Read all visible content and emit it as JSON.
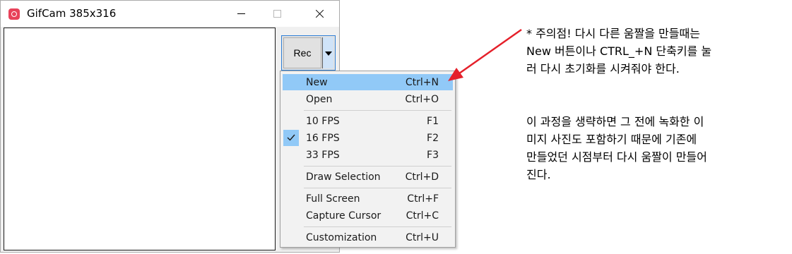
{
  "window": {
    "title": "GifCam 385x316",
    "icon": "camera-icon",
    "rec_label": "Rec"
  },
  "menu": {
    "items": [
      {
        "label": "New",
        "shortcut": "Ctrl+N",
        "highlighted": true
      },
      {
        "label": "Open",
        "shortcut": "Ctrl+O"
      },
      {
        "label": "10 FPS",
        "shortcut": "F1"
      },
      {
        "label": "16 FPS",
        "shortcut": "F2",
        "checked": true
      },
      {
        "label": "33 FPS",
        "shortcut": "F3"
      },
      {
        "label": "Draw Selection",
        "shortcut": "Ctrl+D"
      },
      {
        "label": "Full Screen",
        "shortcut": "Ctrl+F"
      },
      {
        "label": "Capture Cursor",
        "shortcut": "Ctrl+C"
      },
      {
        "label": "Customization",
        "shortcut": "Ctrl+U"
      }
    ]
  },
  "annotation": {
    "paragraph1": "* 주의점! 다시 다른 움짤을 만들때는\nNew 버튼이나 CTRL_+N 단축키를 눌\n러 다시 초기화를 시켜줘야 한다.",
    "paragraph2": "이 과정을 생략하면 그 전에 녹화한 이\n미지 사진도 포함하기 때문에 기존에\n만들었던 시점부터 다시 움짤이 만들어\n진다."
  },
  "colors": {
    "arrow": "#e5202a",
    "menu_highlight": "#91c9f7",
    "rec_border": "#2f7fd6"
  }
}
